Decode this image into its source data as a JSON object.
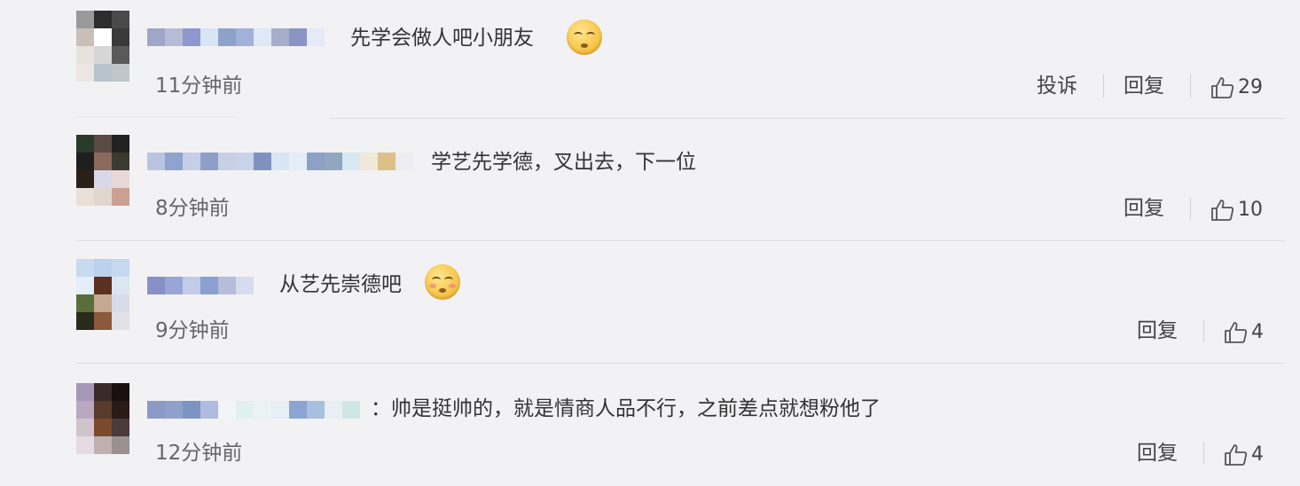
{
  "comments": [
    {
      "text": "先学会做人吧小朋友",
      "emoji": "rolling-eyes-emoji",
      "time": "11分钟前",
      "report_label": "投诉",
      "reply_label": "回复",
      "like_count": "29"
    },
    {
      "text": "学艺先学德，叉出去，下一位",
      "time": "8分钟前",
      "reply_label": "回复",
      "like_count": "10"
    },
    {
      "text": "从艺先崇德吧",
      "emoji": "thinking-emoji",
      "time": "9分钟前",
      "reply_label": "回复",
      "like_count": "4"
    },
    {
      "text": "：帅是挺帅的，就是情商人品不行，之前差点就想粉他了",
      "time": "12分钟前",
      "reply_label": "回复",
      "like_count": "4"
    }
  ],
  "colors": {
    "background": "#f2f2f5",
    "text": "#333333",
    "meta": "#666666",
    "divider": "#dcdce0"
  }
}
